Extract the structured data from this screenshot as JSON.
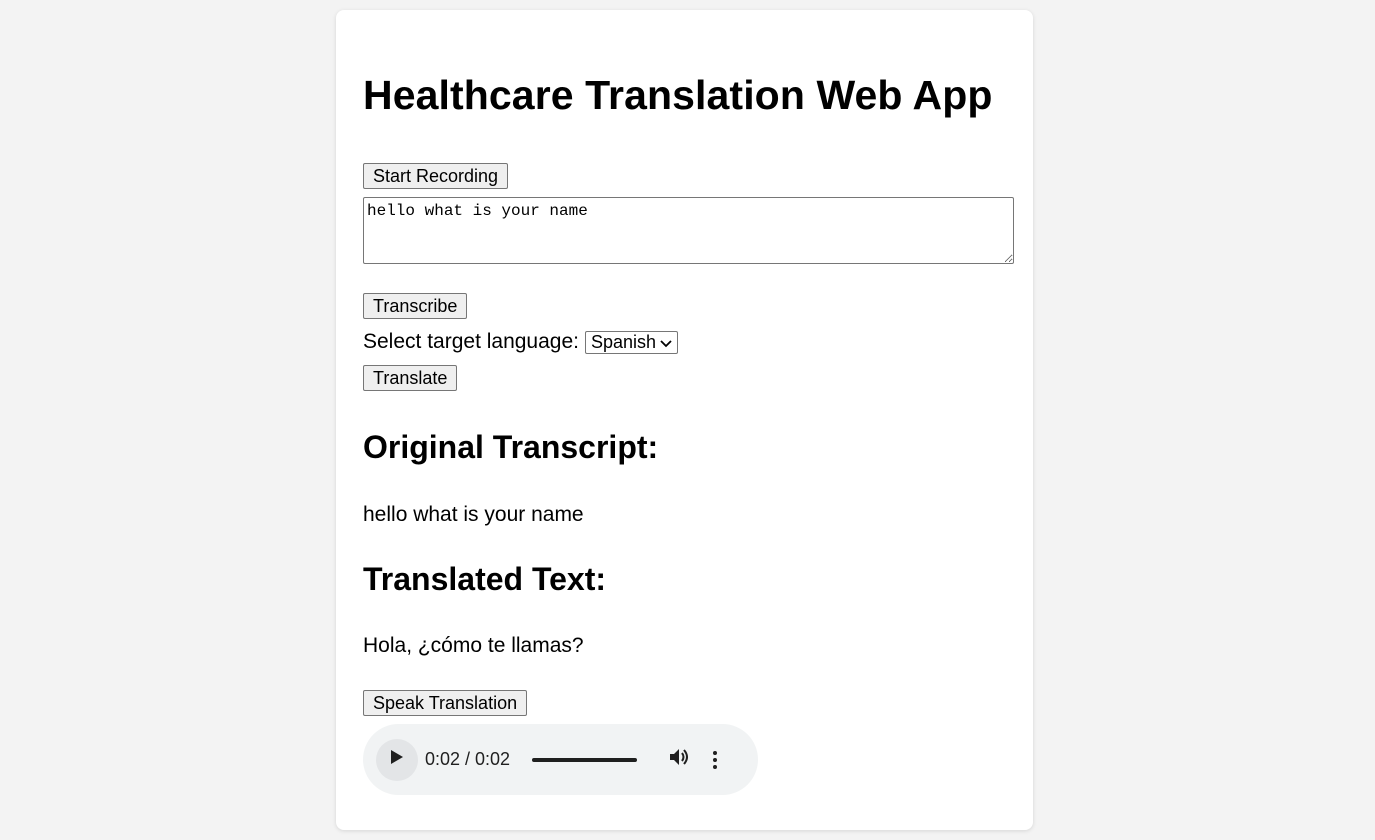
{
  "app": {
    "title": "Healthcare Translation Web App"
  },
  "controls": {
    "start_recording_label": "Start Recording",
    "transcript_input_value": "hello what is your name",
    "transcribe_label": "Transcribe",
    "language_label": "Select target language:",
    "language_selected": "Spanish",
    "translate_label": "Translate"
  },
  "results": {
    "original_heading": "Original Transcript:",
    "original_text": "hello what is your name",
    "translated_heading": "Translated Text:",
    "translated_text": "Hola, ¿cómo te llamas?"
  },
  "speak": {
    "button_label": "Speak Translation"
  },
  "audio": {
    "time_display": "0:02 / 0:02",
    "progress_fraction": 1.0
  },
  "icons": {
    "play": "play-icon",
    "volume": "volume-icon",
    "more": "more-options-icon",
    "dropdown": "chevron-down-icon",
    "resize": "resize-handle-icon"
  }
}
